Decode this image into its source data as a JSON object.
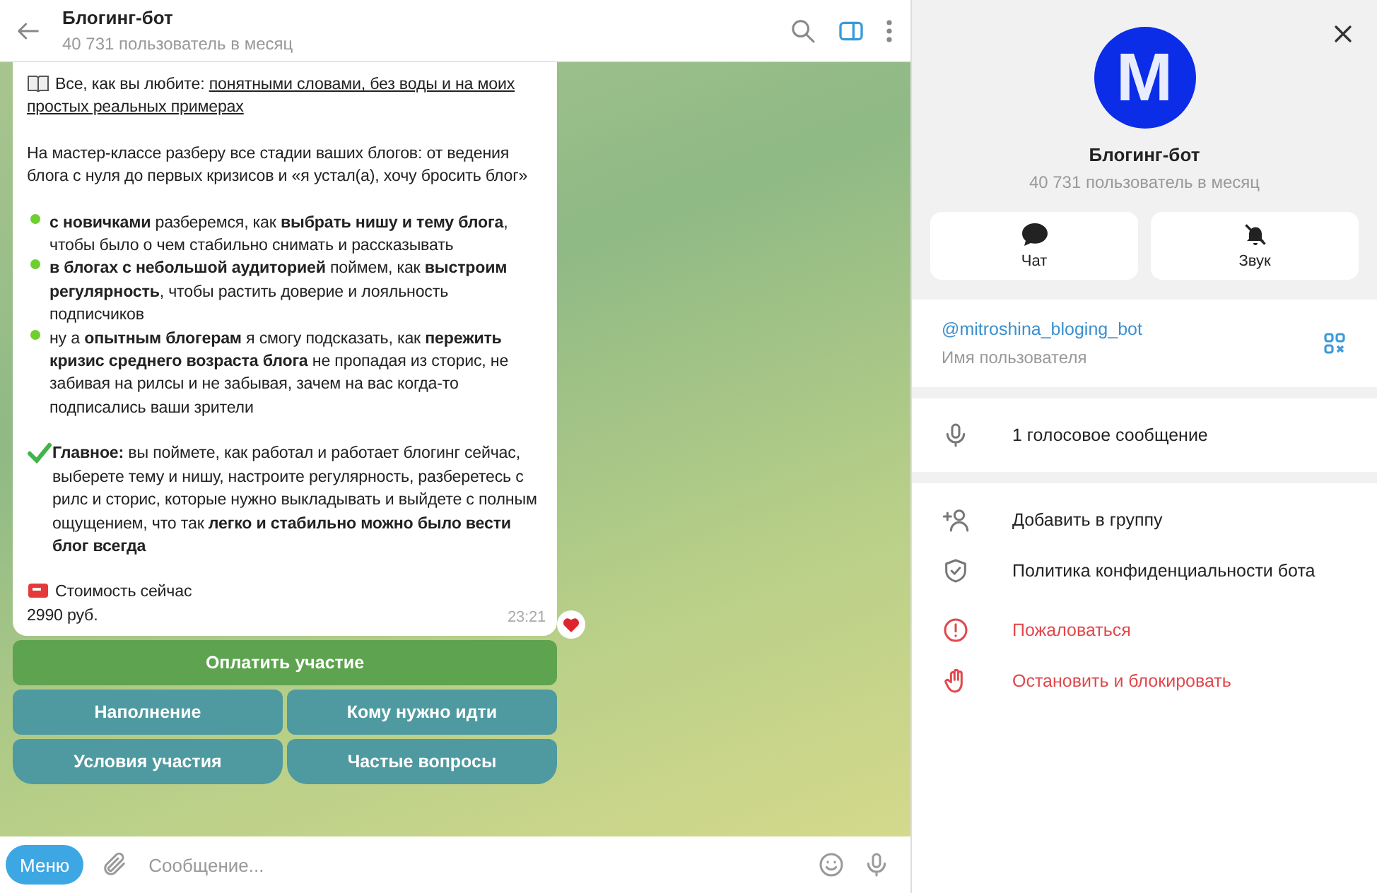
{
  "header": {
    "title": "Блогинг-бот",
    "subtitle": "40 731 пользователь в месяц"
  },
  "message": {
    "paragraphs": [
      {
        "kind": "book",
        "text": "Все, как вы любите:",
        "links": [
          "понятными словами, без воды и на моих",
          "простых реальных примерах"
        ]
      },
      {
        "kind": "plain",
        "text": "На мастер-классе разберу все стадии ваших блогов: от ведения блога с нуля до первых кризисов и «я устал(а), хочу бросить блог»"
      },
      {
        "kind": "bullet",
        "text": "**с новичками** разберемся, как **выбрать нишу и тему блога**, чтобы было о чем стабильно снимать и рассказывать"
      },
      {
        "kind": "bullet",
        "text": "**в блогах с небольшой аудиторией** поймем, как **выстроим регулярность**, чтобы растить доверие и лояльность подписчиков"
      },
      {
        "kind": "bullet",
        "text": " ну а **опытным блогерам** я смогу подсказать, как **пережить кризис среднего возраста блога** не пропадая из сторис, не забивая на рилсы и не забывая, зачем на вас когда-то подписались ваши зрители"
      },
      {
        "kind": "check",
        "text": "**Главное:** вы поймете, как работал и работает блогинг сейчас, выберете тему и нишу, настроите регулярность, разберетесь с рилс и сторис, которые нужно выкладывать и выйдете с полным ощущением, что так **легко и стабильно можно было вести блог всегда**"
      },
      {
        "kind": "price",
        "text": "Стоимость сейчас",
        "price": "2990 руб."
      }
    ],
    "time": "23:21"
  },
  "keyboard": [
    [
      {
        "label": "Оплатить участие",
        "color": "#5ea350"
      }
    ],
    [
      {
        "label": "Наполнение",
        "color": "#4e9aa0"
      },
      {
        "label": "Кому нужно идти",
        "color": "#4e9aa0"
      }
    ],
    [
      {
        "label": "Условия участия",
        "color": "#4e9aa0"
      },
      {
        "label": "Частые вопросы",
        "color": "#4e9aa0"
      }
    ]
  ],
  "composer": {
    "menu": "Меню",
    "placeholder": "Сообщение..."
  },
  "profile": {
    "avatar_letter": "M",
    "name": "Блогинг-бот",
    "subtitle": "40 731 пользователь в месяц",
    "actions": [
      {
        "kind": "chat",
        "label": "Чат"
      },
      {
        "kind": "mute",
        "label": "Звук"
      }
    ],
    "username": "@mitroshina_bloging_bot",
    "username_caption": "Имя пользователя",
    "media": [
      {
        "kind": "voice",
        "label": "1 голосовое сообщение"
      }
    ],
    "menu": [
      {
        "kind": "add",
        "label": "Добавить в группу",
        "danger": false
      },
      {
        "kind": "privacy",
        "label": "Политика конфиденциальности бота",
        "danger": false
      },
      {
        "kind": "report",
        "label": "Пожаловаться",
        "danger": true
      },
      {
        "kind": "block",
        "label": "Остановить и блокировать",
        "danger": true
      }
    ]
  }
}
